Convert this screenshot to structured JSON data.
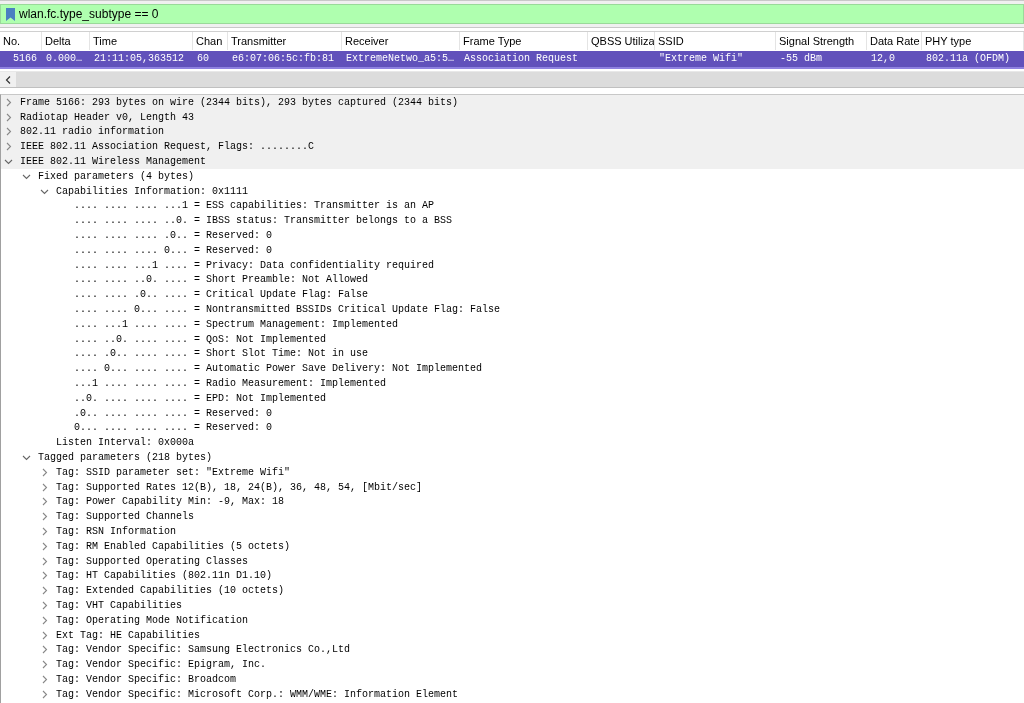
{
  "filter": {
    "value": "wlan.fc.type_subtype == 0"
  },
  "packet_list": {
    "columns": [
      {
        "label": "No."
      },
      {
        "label": "Delta"
      },
      {
        "label": "Time"
      },
      {
        "label": "Chan"
      },
      {
        "label": "Transmitter"
      },
      {
        "label": "Receiver"
      },
      {
        "label": "Frame Type"
      },
      {
        "label": "QBSS Utiliza"
      },
      {
        "label": "SSID"
      },
      {
        "label": "Signal Strength"
      },
      {
        "label": "Data Rate"
      },
      {
        "label": "PHY type"
      }
    ],
    "rows": [
      {
        "selected": true,
        "cells": [
          "5166",
          "0.000…",
          "21:11:05,363512",
          "60",
          "e6:07:06:5c:fb:81",
          "ExtremeNetwo_a5:5…",
          "Association Request",
          "",
          "\"Extreme Wifi\"",
          "-55 dBm",
          "12,0",
          "802.11a (OFDM)"
        ]
      }
    ]
  },
  "details": [
    {
      "text": "Frame 5166: 293 bytes on wire (2344 bits), 293 bytes captured (2344 bits)",
      "expanded": false
    },
    {
      "text": "Radiotap Header v0, Length 43",
      "expanded": false
    },
    {
      "text": "802.11 radio information",
      "expanded": false
    },
    {
      "text": "IEEE 802.11 Association Request, Flags: ........C",
      "expanded": false
    },
    {
      "text": "IEEE 802.11 Wireless Management",
      "expanded": true,
      "children": [
        {
          "text": "Fixed parameters (4 bytes)",
          "expanded": true,
          "children": [
            {
              "text": "Capabilities Information: 0x1111",
              "expanded": true,
              "children": [
                {
                  "text": ".... .... .... ...1 = ESS capabilities: Transmitter is an AP"
                },
                {
                  "text": ".... .... .... ..0. = IBSS status: Transmitter belongs to a BSS"
                },
                {
                  "text": ".... .... .... .0.. = Reserved: 0"
                },
                {
                  "text": ".... .... .... 0... = Reserved: 0"
                },
                {
                  "text": ".... .... ...1 .... = Privacy: Data confidentiality required"
                },
                {
                  "text": ".... .... ..0. .... = Short Preamble: Not Allowed"
                },
                {
                  "text": ".... .... .0.. .... = Critical Update Flag: False"
                },
                {
                  "text": ".... .... 0... .... = Nontransmitted BSSIDs Critical Update Flag: False"
                },
                {
                  "text": ".... ...1 .... .... = Spectrum Management: Implemented"
                },
                {
                  "text": ".... ..0. .... .... = QoS: Not Implemented"
                },
                {
                  "text": ".... .0.. .... .... = Short Slot Time: Not in use"
                },
                {
                  "text": ".... 0... .... .... = Automatic Power Save Delivery: Not Implemented"
                },
                {
                  "text": "...1 .... .... .... = Radio Measurement: Implemented"
                },
                {
                  "text": "..0. .... .... .... = EPD: Not Implemented"
                },
                {
                  "text": ".0.. .... .... .... = Reserved: 0"
                },
                {
                  "text": "0... .... .... .... = Reserved: 0"
                }
              ]
            },
            {
              "text": "Listen Interval: 0x000a"
            }
          ]
        },
        {
          "text": "Tagged parameters (218 bytes)",
          "expanded": true,
          "children": [
            {
              "text": "Tag: SSID parameter set: \"Extreme Wifi\"",
              "expanded": false
            },
            {
              "text": "Tag: Supported Rates 12(B), 18, 24(B), 36, 48, 54, [Mbit/sec]",
              "expanded": false
            },
            {
              "text": "Tag: Power Capability Min: -9, Max: 18",
              "expanded": false
            },
            {
              "text": "Tag: Supported Channels",
              "expanded": false
            },
            {
              "text": "Tag: RSN Information",
              "expanded": false
            },
            {
              "text": "Tag: RM Enabled Capabilities (5 octets)",
              "expanded": false
            },
            {
              "text": "Tag: Supported Operating Classes",
              "expanded": false
            },
            {
              "text": "Tag: HT Capabilities (802.11n D1.10)",
              "expanded": false
            },
            {
              "text": "Tag: Extended Capabilities (10 octets)",
              "expanded": false
            },
            {
              "text": "Tag: VHT Capabilities",
              "expanded": false
            },
            {
              "text": "Tag: Operating Mode Notification",
              "expanded": false
            },
            {
              "text": "Ext Tag: HE Capabilities",
              "expanded": false
            },
            {
              "text": "Tag: Vendor Specific: Samsung Electronics Co.,Ltd",
              "expanded": false
            },
            {
              "text": "Tag: Vendor Specific: Epigram, Inc.",
              "expanded": false
            },
            {
              "text": "Tag: Vendor Specific: Broadcom",
              "expanded": false
            },
            {
              "text": "Tag: Vendor Specific: Microsoft Corp.: WMM/WME: Information Element",
              "expanded": false
            }
          ]
        }
      ]
    }
  ]
}
